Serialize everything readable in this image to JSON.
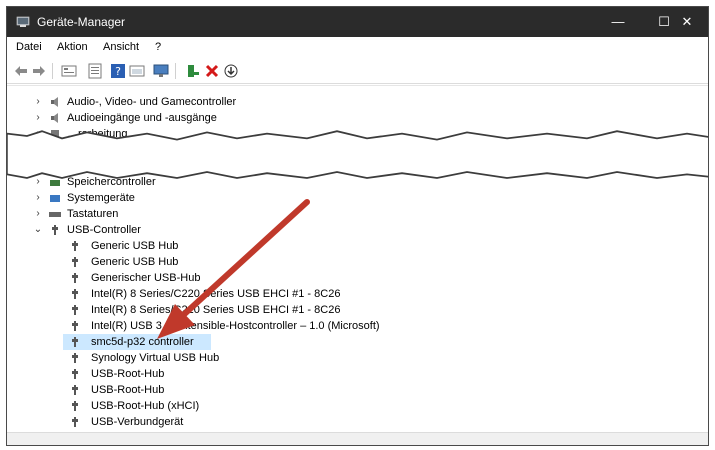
{
  "window": {
    "title": "Geräte-Manager"
  },
  "menu": [
    "Datei",
    "Aktion",
    "Ansicht",
    "?"
  ],
  "tree": {
    "top_items": [
      {
        "label": "Audio-, Video- und Gamecontroller",
        "icon": "speaker-icon"
      },
      {
        "label": "Audioeingänge und -ausgänge",
        "icon": "speaker-icon"
      },
      {
        "label": "…rarbeitung",
        "icon": "cpu-icon"
      }
    ],
    "bottom_items": [
      {
        "label": "Speichercontroller",
        "icon": "storage-icon"
      },
      {
        "label": "Systemgeräte",
        "icon": "folder-icon"
      },
      {
        "label": "Tastaturen",
        "icon": "keyboard-icon"
      },
      {
        "label": "USB-Controller",
        "icon": "usb-icon"
      }
    ],
    "usb_children": [
      "Generic USB Hub",
      "Generic USB Hub",
      "Generischer USB-Hub",
      "Intel(R) 8 Series/C220 Series USB EHCI #1 - 8C26",
      "Intel(R) 8 Series/C220 Series USB EHCI #1 - 8C26",
      "Intel(R) USB 3.0 eXtensible-Hostcontroller – 1.0 (Microsoft)",
      "smc5d-p32 controller",
      "Synology Virtual USB Hub",
      "USB-Root-Hub",
      "USB-Root-Hub",
      "USB-Root-Hub (xHCI)",
      "USB-Verbundgerät"
    ],
    "selected_index": 6
  },
  "colors": {
    "titlebar": "#2b2b2b",
    "selection": "#cce8ff",
    "arrow": "#c0392b"
  }
}
